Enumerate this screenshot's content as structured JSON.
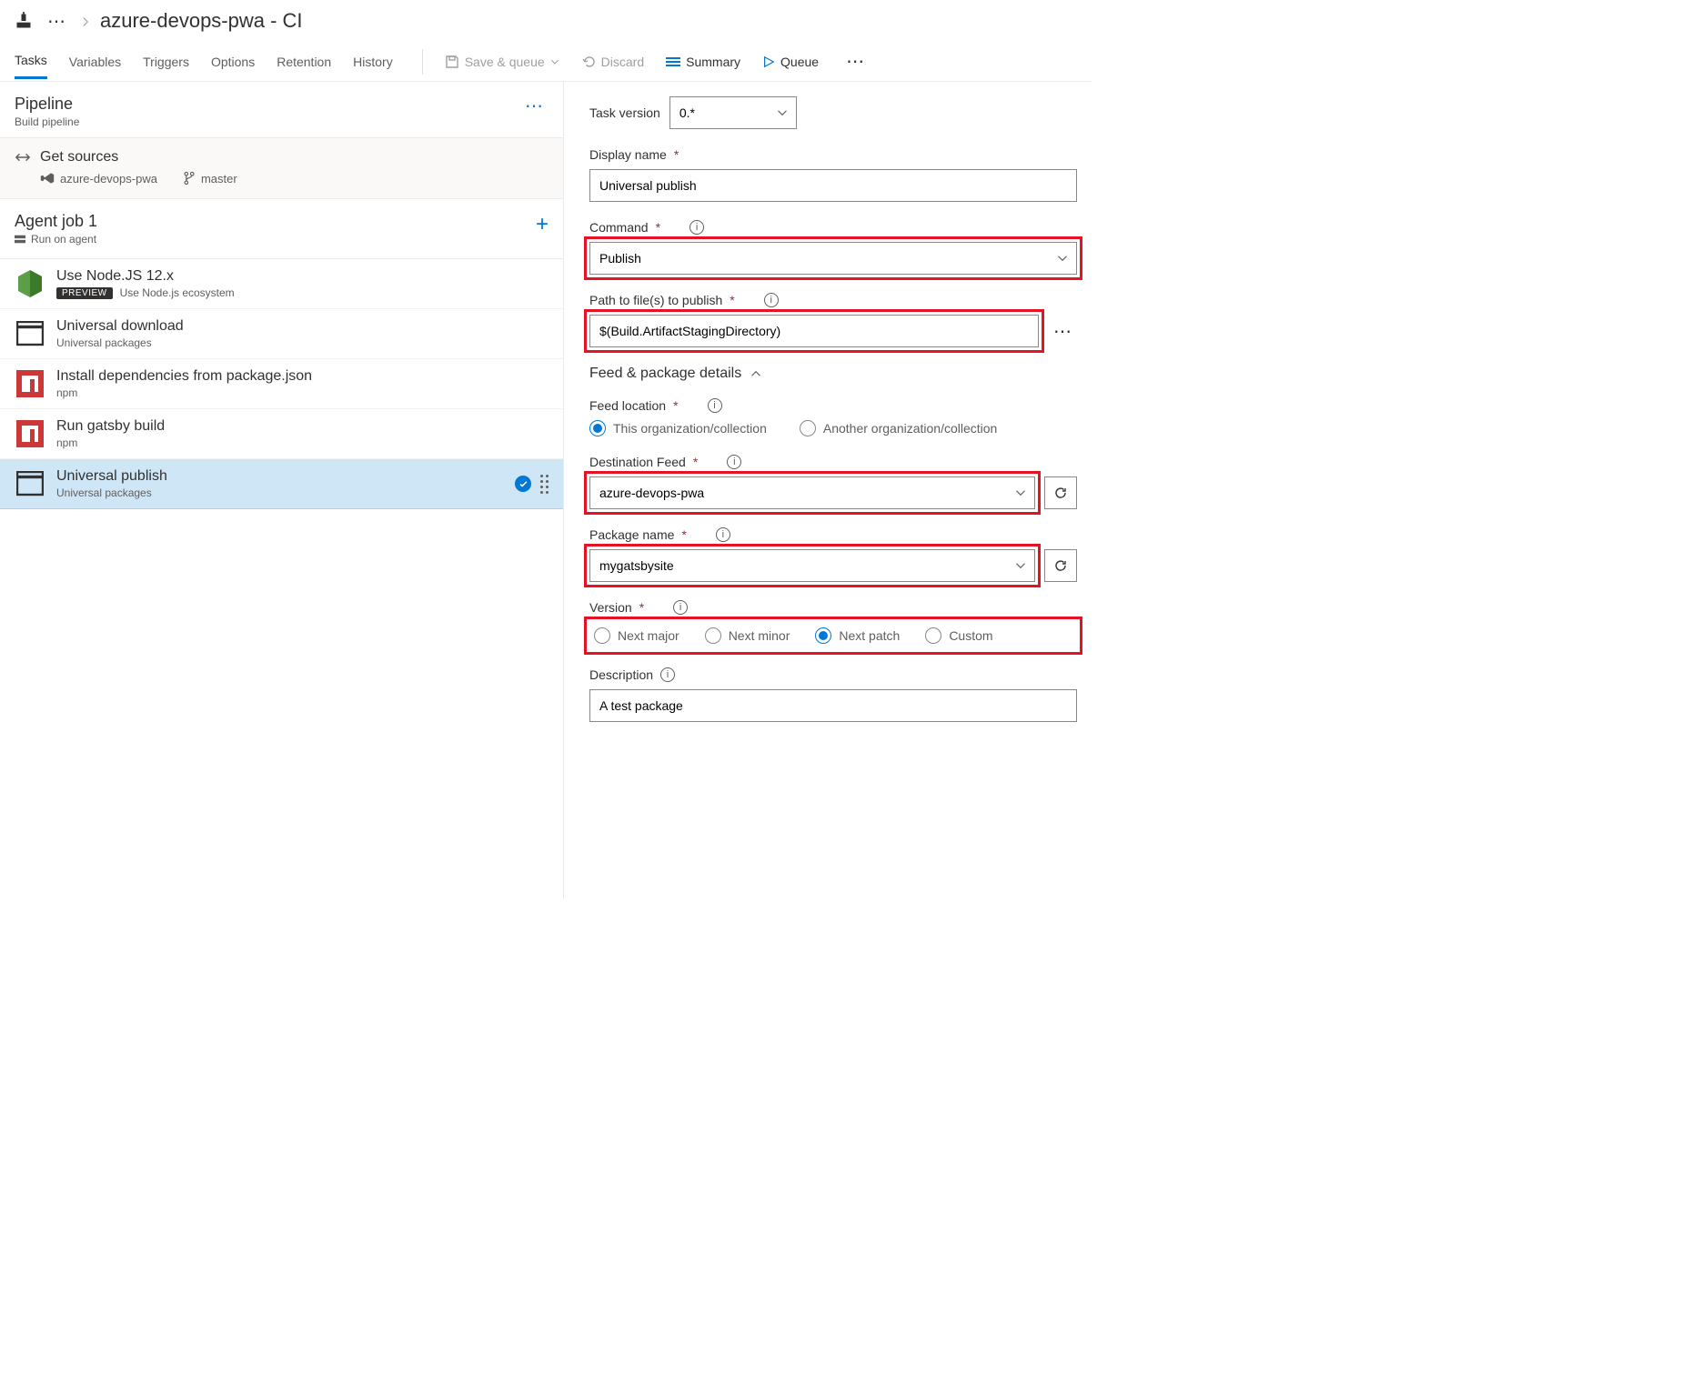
{
  "breadcrumb": {
    "title": "azure-devops-pwa - CI"
  },
  "tabs": [
    "Tasks",
    "Variables",
    "Triggers",
    "Options",
    "Retention",
    "History"
  ],
  "tabs_active_index": 0,
  "commands": {
    "save_queue": "Save & queue",
    "discard": "Discard",
    "summary": "Summary",
    "queue": "Queue"
  },
  "pipeline": {
    "title": "Pipeline",
    "subtitle": "Build pipeline"
  },
  "sources": {
    "title": "Get sources",
    "repo": "azure-devops-pwa",
    "branch": "master"
  },
  "agent": {
    "title": "Agent job 1",
    "subtitle": "Run on agent"
  },
  "task_list": [
    {
      "title": "Use Node.JS 12.x",
      "sub": "Use Node.js ecosystem",
      "preview": true
    },
    {
      "title": "Universal download",
      "sub": "Universal packages",
      "preview": false
    },
    {
      "title": "Install dependencies from package.json",
      "sub": "npm",
      "preview": false
    },
    {
      "title": "Run gatsby build",
      "sub": "npm",
      "preview": false
    },
    {
      "title": "Universal publish",
      "sub": "Universal packages",
      "preview": false,
      "selected": true
    }
  ],
  "form": {
    "task_version_label": "Task version",
    "task_version_value": "0.*",
    "display_name_label": "Display name",
    "display_name_value": "Universal publish",
    "command_label": "Command",
    "command_value": "Publish",
    "path_label": "Path to file(s) to publish",
    "path_value": "$(Build.ArtifactStagingDirectory)",
    "feed_section": "Feed & package details",
    "feed_location_label": "Feed location",
    "feed_location_options": [
      "This organization/collection",
      "Another organization/collection"
    ],
    "feed_location_selected_index": 0,
    "dest_feed_label": "Destination Feed",
    "dest_feed_value": "azure-devops-pwa",
    "pkg_name_label": "Package name",
    "pkg_name_value": "mygatsbysite",
    "version_label": "Version",
    "version_options": [
      "Next major",
      "Next minor",
      "Next patch",
      "Custom"
    ],
    "version_selected_index": 2,
    "description_label": "Description",
    "description_value": "A test package"
  },
  "misc": {
    "preview_badge": "PREVIEW"
  }
}
